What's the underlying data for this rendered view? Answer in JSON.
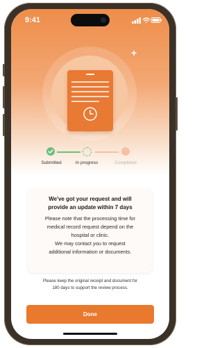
{
  "status_bar": {
    "time": "9:41"
  },
  "icons": {
    "signal": "signal-icon",
    "wifi": "wifi-icon",
    "battery": "battery-icon",
    "sparkle": "sparkle-icon",
    "document": "document-icon",
    "clock": "clock-icon",
    "check": "check-icon"
  },
  "stepper": {
    "steps": [
      {
        "label": "Submitted",
        "state": "done"
      },
      {
        "label": "In progress",
        "state": "current"
      },
      {
        "label": "Completed",
        "state": "pending"
      }
    ]
  },
  "card": {
    "title_line1": "We've got your request and will",
    "title_line2": "provide an update within 7 days",
    "body_line1": "Please note that the processing time for",
    "body_line2": "medical record request depend on the",
    "body_line3": "hospital or clinic.",
    "body_line4": "We may contact you to request",
    "body_line5": "additional information or documents."
  },
  "footnote": {
    "line1": "Please keep the original receipt and document for",
    "line2": "180 days to support the review process."
  },
  "done_button": {
    "label": "Done"
  },
  "colors": {
    "accent": "#e8792d",
    "hero_top": "#ee8d4a",
    "success": "#6cbf7a",
    "pending": "#f4c2a0"
  }
}
